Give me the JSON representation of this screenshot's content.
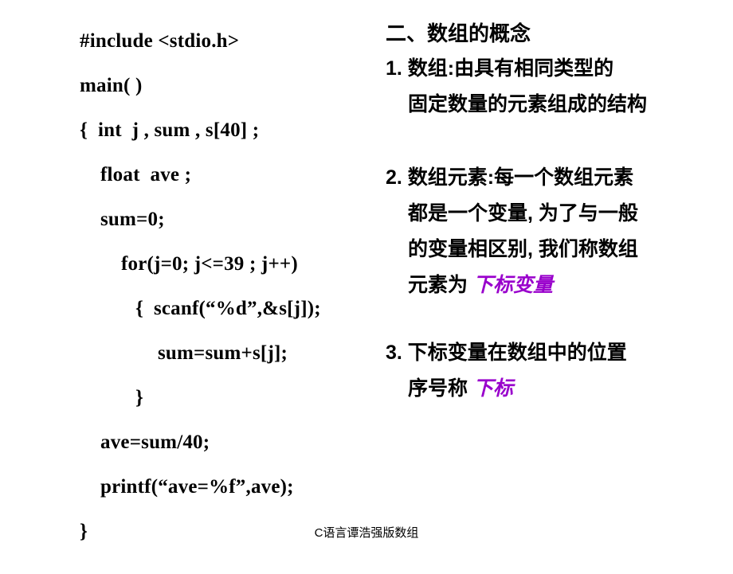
{
  "slide": {
    "background_color": "#ffffff",
    "text_color": "#000000",
    "highlight_color": "#9900cc"
  },
  "code_column": {
    "language": "c",
    "lines": [
      {
        "text": "#include <stdio.h>",
        "indent": 0
      },
      {
        "text": "main( )",
        "indent": 0
      },
      {
        "text": "{  int  j , sum , s[40] ;",
        "indent": 0
      },
      {
        "text": "float  ave ;",
        "indent": 1
      },
      {
        "text": "sum=0;",
        "indent": 1
      },
      {
        "text": "for(j=0; j<=39 ; j++)",
        "indent": 2
      },
      {
        "text": "{  scanf(“%d”,&s[j]);",
        "indent": 3
      },
      {
        "text": "sum=sum+s[j];",
        "indent": 4
      },
      {
        "text": "}",
        "indent": 3
      },
      {
        "text": "ave=sum/40;",
        "indent": 1
      },
      {
        "text": "printf(“ave=%f”,ave);",
        "indent": 1
      },
      {
        "text": "}",
        "indent": 0
      }
    ]
  },
  "notes_column": {
    "heading": "二、数组的概念",
    "items": [
      {
        "number": "1.",
        "lines": [
          {
            "lead": "1. ",
            "text": "数组:由具有相同类型的",
            "highlight": ""
          },
          {
            "lead": "",
            "text": "固定数量的元素组成的结构",
            "highlight": ""
          }
        ]
      },
      {
        "number": "2.",
        "lines": [
          {
            "lead": "2. ",
            "text": "数组元素:每一个数组元素",
            "highlight": ""
          },
          {
            "lead": "",
            "text": "都是一个变量, 为了与一般",
            "highlight": ""
          },
          {
            "lead": "",
            "text": "的变量相区别, 我们称数组",
            "highlight": ""
          },
          {
            "lead": "",
            "text": "元素为 ",
            "highlight": "下标变量"
          }
        ]
      },
      {
        "number": "3.",
        "lines": [
          {
            "lead": "3. ",
            "text": "下标变量在数组中的位置",
            "highlight": ""
          },
          {
            "lead": "",
            "text": "序号称 ",
            "highlight": "下标"
          }
        ]
      }
    ]
  },
  "footer": {
    "text": "C语言谭浩强版数组"
  }
}
